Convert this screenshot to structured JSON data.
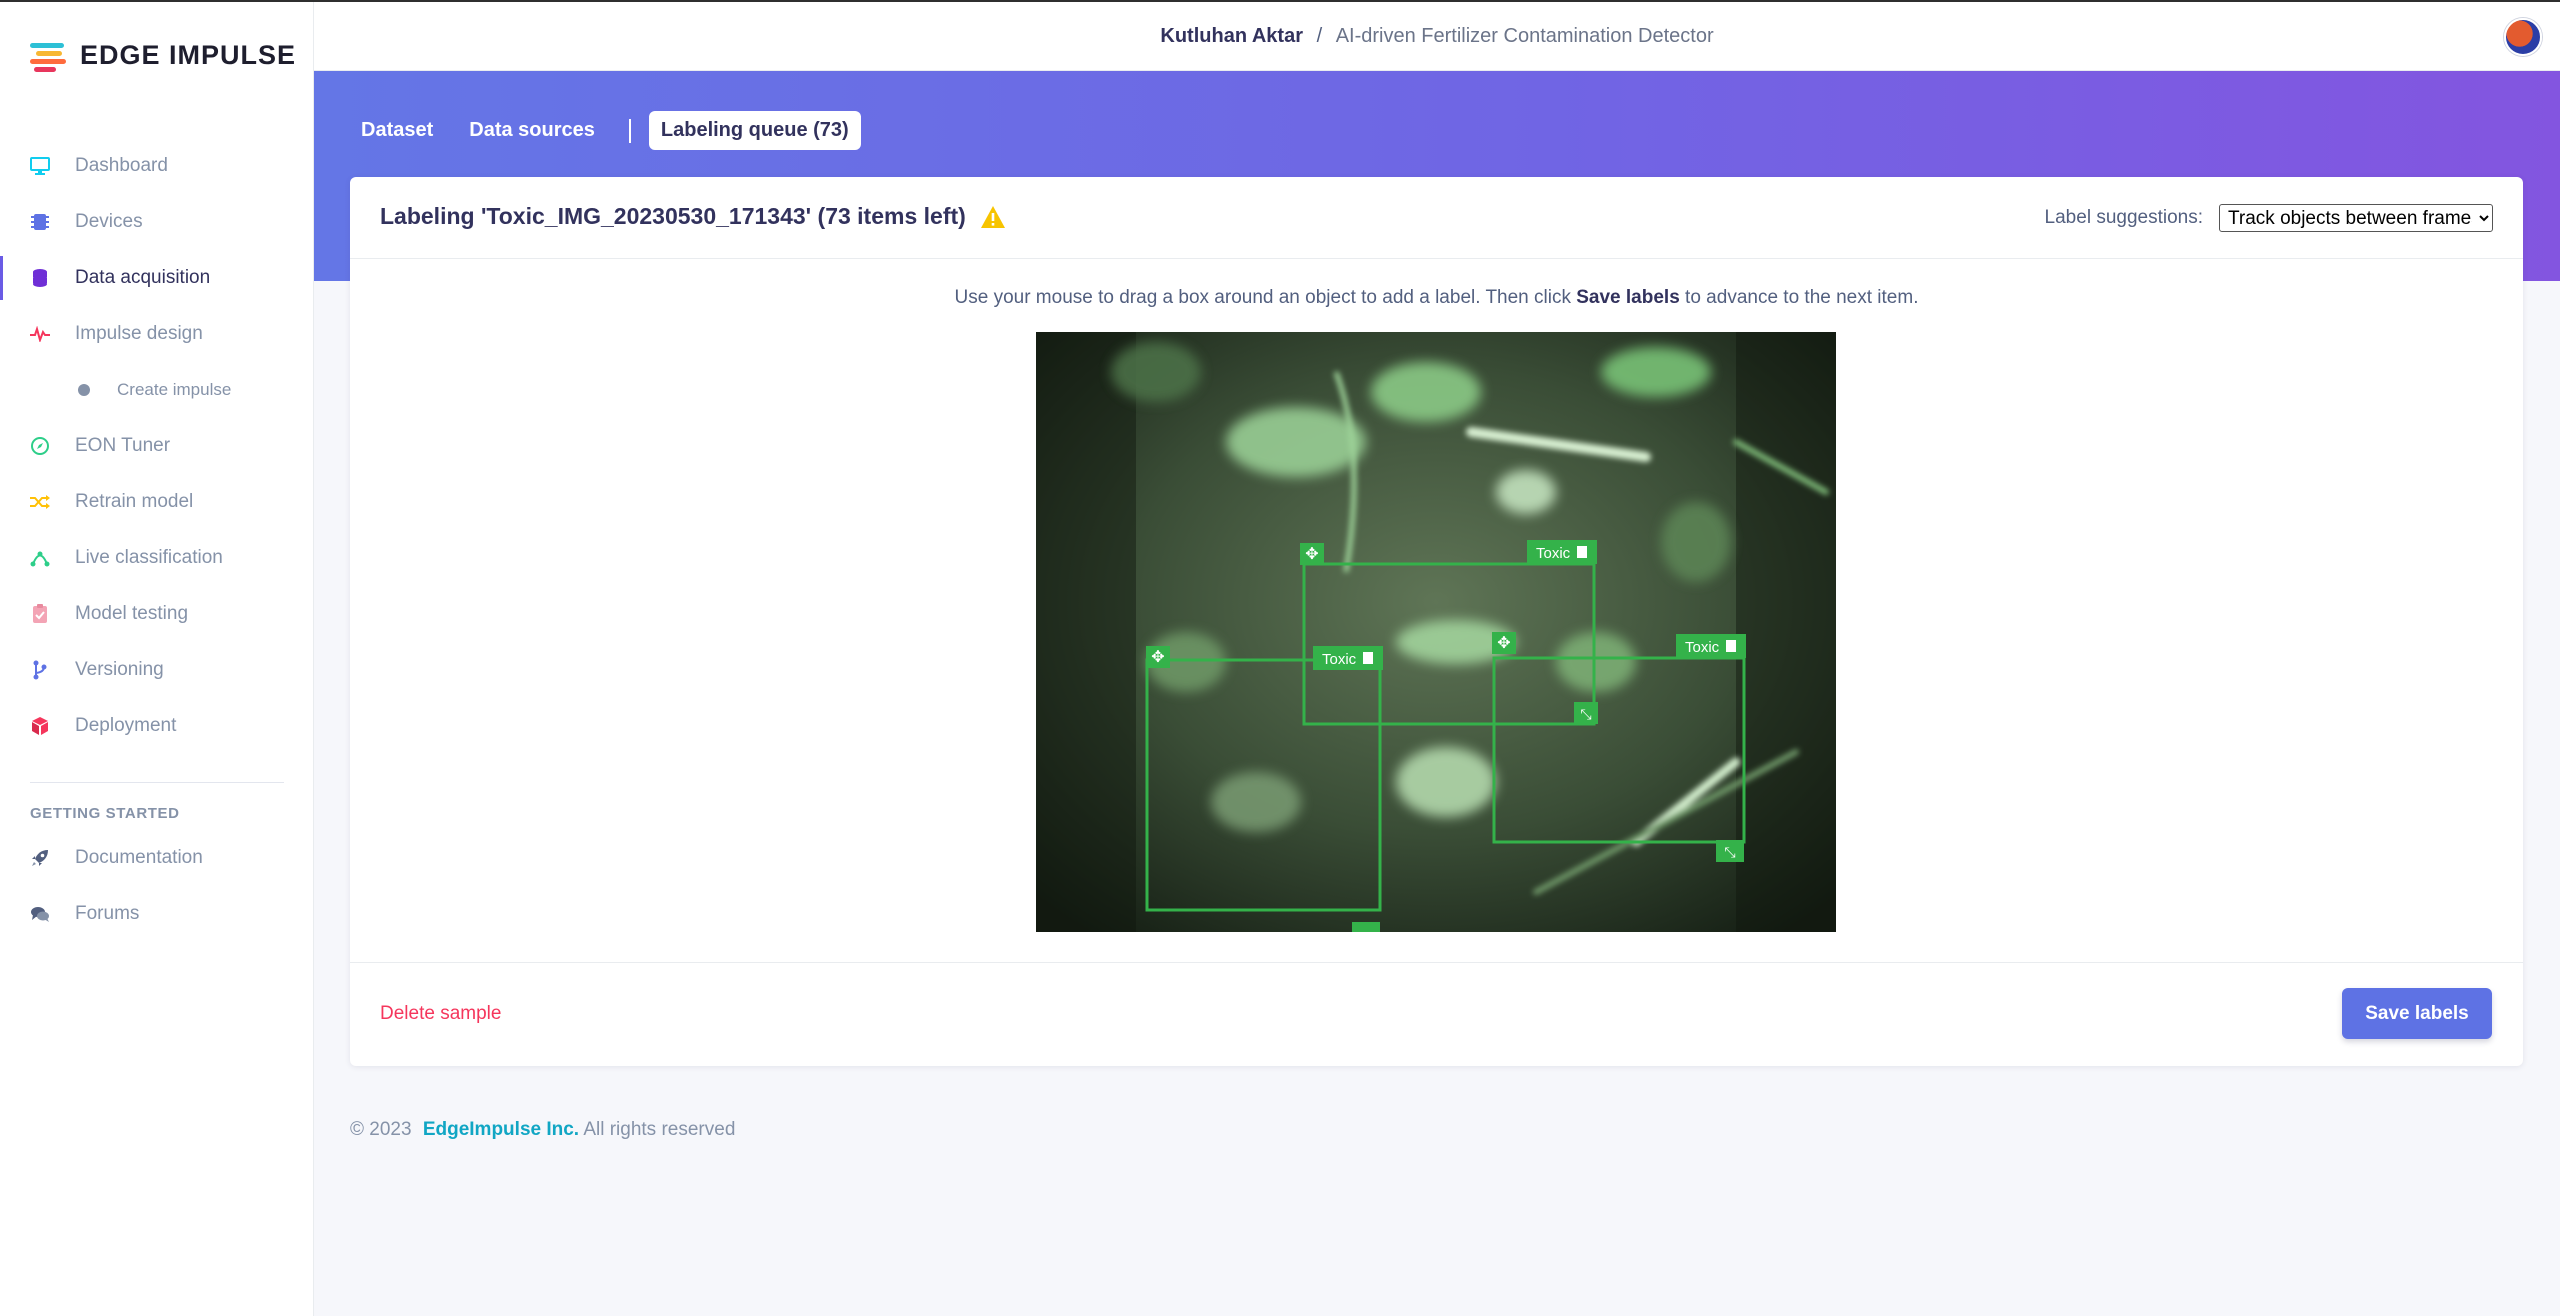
{
  "app": {
    "logo_text": "EDGE IMPULSE"
  },
  "topbar": {
    "owner": "Kutluhan Aktar",
    "separator": "/",
    "project": "AI-driven Fertilizer Contamination Detector"
  },
  "sidebar": {
    "items": [
      {
        "label": "Dashboard",
        "icon": "monitor-icon",
        "color": "#11cdef"
      },
      {
        "label": "Devices",
        "icon": "chip-icon",
        "color": "#5e72e4"
      },
      {
        "label": "Data acquisition",
        "icon": "database-icon",
        "color": "#6f2fd6"
      },
      {
        "label": "Impulse design",
        "icon": "pulse-icon",
        "color": "#f5365c"
      },
      {
        "label": "Create impulse",
        "icon": "dot-icon",
        "color": "#8592a8"
      },
      {
        "label": "EON Tuner",
        "icon": "compass-icon",
        "color": "#2dce89"
      },
      {
        "label": "Retrain model",
        "icon": "shuffle-icon",
        "color": "#ffc107"
      },
      {
        "label": "Live classification",
        "icon": "network-icon",
        "color": "#2dce89"
      },
      {
        "label": "Model testing",
        "icon": "clipboard-check-icon",
        "color": "#f3a4b5"
      },
      {
        "label": "Versioning",
        "icon": "branch-icon",
        "color": "#5e72e4"
      },
      {
        "label": "Deployment",
        "icon": "cube-icon",
        "color": "#f5365c"
      }
    ],
    "section_heading": "GETTING STARTED",
    "help_items": [
      {
        "label": "Documentation",
        "icon": "rocket-icon"
      },
      {
        "label": "Forums",
        "icon": "comments-icon"
      }
    ]
  },
  "tabs": {
    "dataset": "Dataset",
    "data_sources": "Data sources",
    "labeling_queue": "Labeling queue (73)"
  },
  "card": {
    "title": "Labeling 'Toxic_IMG_20230530_171343' (73 items left)",
    "suggestions_label": "Label suggestions:",
    "suggestions_value": "Track objects between frames",
    "instructions_pre": "Use your mouse to drag a box around an object to add a label. Then click ",
    "instructions_bold": "Save labels",
    "instructions_post": " to advance to the next item.",
    "delete": "Delete sample",
    "save": "Save labels"
  },
  "bounding_boxes": [
    {
      "label": "Toxic"
    },
    {
      "label": "Toxic"
    },
    {
      "label": "Toxic"
    }
  ],
  "footer": {
    "copyright": "© 2023",
    "company": "EdgeImpulse Inc.",
    "rights": "All rights reserved"
  },
  "colors": {
    "accent": "#5e72e4",
    "box": "#34b24a",
    "danger": "#f5365c",
    "warning": "#f7c400"
  }
}
